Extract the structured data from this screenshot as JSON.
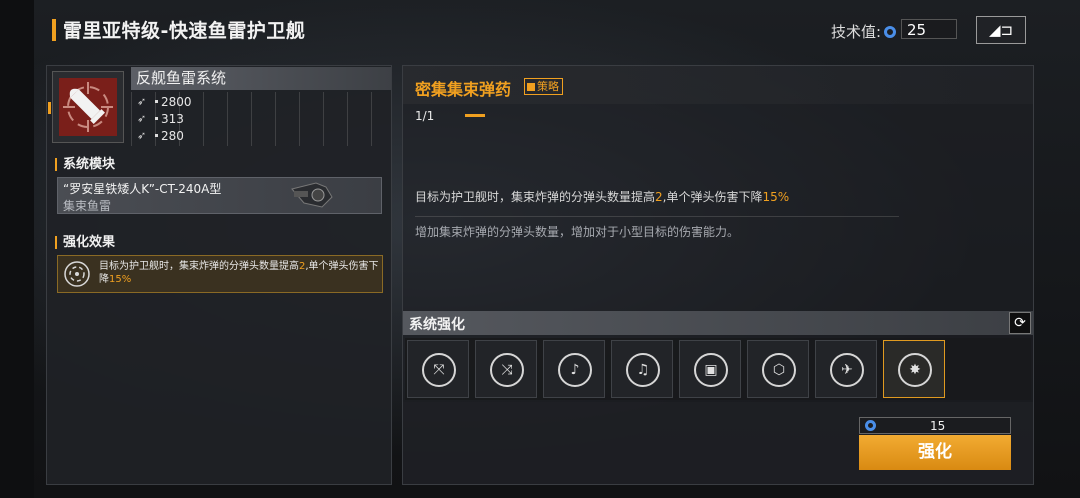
{
  "header": {
    "title": "雷里亚特级-快速鱼雷护卫舰",
    "tech_label": "技术值:",
    "tech_value": "25",
    "back_label": "◢⊐"
  },
  "left": {
    "system_name": "反舰鱼雷系统",
    "stats": [
      {
        "icon": "attack-icon",
        "value": "2800"
      },
      {
        "icon": "range-icon",
        "value": "313"
      },
      {
        "icon": "speed-icon",
        "value": "280"
      }
    ],
    "module_section": "系统模块",
    "module": {
      "name": "“罗安星铁矮人K”-CT-240A型",
      "type": "集束鱼雷"
    },
    "effect_section": "强化效果",
    "effect": {
      "text_1": "目标为护卫舰时，集束炸弹的分弹头数量提高",
      "num_1": "2",
      "text_2": ",单个弹头伤害下降",
      "num_2": "15%"
    }
  },
  "right": {
    "skill_name": "密集集束弹药",
    "tag": "策略",
    "page": "1/1",
    "desc1": {
      "text_1": "目标为护卫舰时，集束炸弹的分弹头数量提高",
      "num_1": "2",
      "text_2": ",单个弹头伤害下降",
      "num_2": "15%"
    },
    "desc2": "增加集束炸弹的分弹头数量，增加对于小型目标的伤害能力。",
    "enh_title": "系统强化",
    "slots": [
      {
        "icon": "missile-cluster-icon",
        "glyph": "⤧"
      },
      {
        "icon": "double-missile-icon",
        "glyph": "⤨"
      },
      {
        "icon": "guitar-missile-icon",
        "glyph": "♪"
      },
      {
        "icon": "guitar-missile-icon",
        "glyph": "♫"
      },
      {
        "icon": "chip-icon",
        "glyph": "▣"
      },
      {
        "icon": "cube-icon",
        "glyph": "⬡"
      },
      {
        "icon": "drone-icon",
        "glyph": "✈"
      },
      {
        "icon": "target-cluster-icon",
        "glyph": "✸"
      }
    ],
    "cost": "15",
    "enhance_label": "强化"
  },
  "colors": {
    "accent": "#f0a020",
    "gem": "#4a8ee8"
  }
}
